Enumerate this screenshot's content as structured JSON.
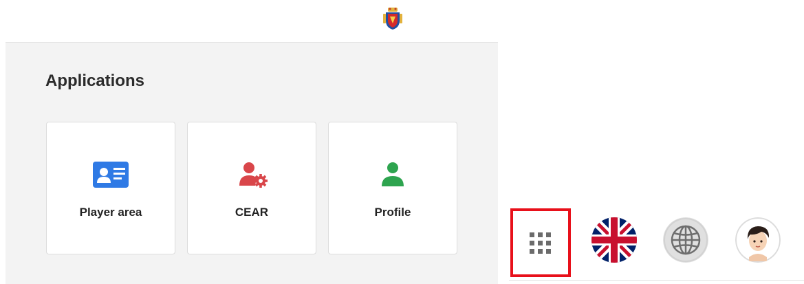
{
  "apps": {
    "title": "Applications",
    "cards": [
      {
        "label": "Player area",
        "icon": "id-card-icon",
        "color": "#2f7ae5"
      },
      {
        "label": "CEAR",
        "icon": "user-gear-icon",
        "color": "#d9464a"
      },
      {
        "label": "Profile",
        "icon": "user-icon",
        "color": "#2ea44f"
      }
    ]
  },
  "toolbar": {
    "apps_icon": "apps-grid-icon",
    "language_icon": "uk-flag-icon",
    "region_icon": "globe-icon",
    "user_icon": "avatar"
  },
  "colors": {
    "highlight": "#e8101a",
    "panel_bg": "#f3f3f3"
  }
}
